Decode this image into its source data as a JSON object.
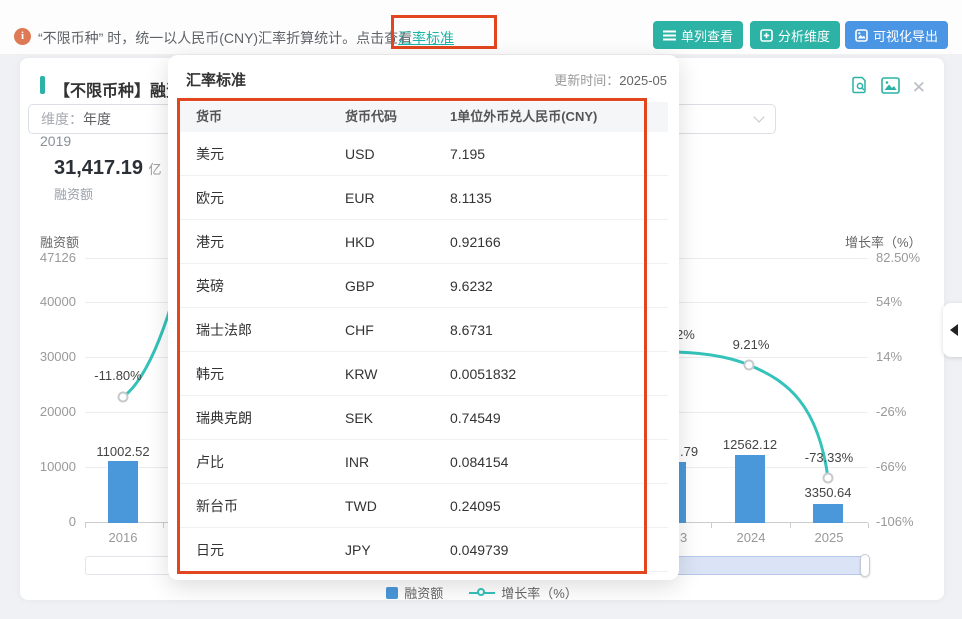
{
  "topbar": {
    "notice": "“不限币种” 时，统一以人民币(CNY)汇率折算统计。点击查看",
    "link_label": "汇率标准",
    "buttons": [
      {
        "label": "单列查看",
        "icon": "list-icon"
      },
      {
        "label": "分析维度",
        "icon": "add-dimension-icon"
      },
      {
        "label": "可视化导出",
        "icon": "export-image-icon"
      }
    ]
  },
  "card": {
    "title": "【不限币种】融资趋势",
    "dimension_select": {
      "label": "维度：",
      "value": "年度"
    },
    "kpi": {
      "year": "2019",
      "value": "31,417.19",
      "unit": "亿",
      "metric": "融资额"
    },
    "action_icons": [
      "doc-search-icon",
      "image-icon",
      "close-icon"
    ],
    "legend": [
      {
        "label": "融资额",
        "type": "bar",
        "swatch": "#4a97d9"
      },
      {
        "label": "增长率（%）",
        "type": "line",
        "swatch": "#35c2ba"
      }
    ]
  },
  "chart_data": {
    "type": "bar+line",
    "title": "【不限币种】融资趋势",
    "left_axis": {
      "label": "融资额",
      "ticks": [
        "47126",
        "40000",
        "30000",
        "20000",
        "10000",
        "0"
      ],
      "ylim": [
        0,
        47126
      ]
    },
    "right_axis": {
      "label": "增长率（%）",
      "ticks": [
        "82.50%",
        "54%",
        "14%",
        "-26%",
        "-66%",
        "-106%"
      ],
      "ylim": [
        -106,
        82.5
      ]
    },
    "x_axis": {
      "visible_labels": [
        "2016",
        "3",
        "2024",
        "2025"
      ]
    },
    "series": [
      {
        "name": "融资额",
        "type": "bar",
        "unit": "亿",
        "visible_points": [
          {
            "x": "2016",
            "value": 11002.52,
            "label": "11002.52"
          },
          {
            "x": "2024",
            "value": 12562.12,
            "label": "12562.12"
          },
          {
            "x": "2025",
            "value": 3350.64,
            "label": "3350.64"
          }
        ]
      },
      {
        "name": "增长率（%）",
        "type": "line",
        "visible_points": [
          {
            "x": "2016",
            "value": -11.8,
            "label": "-11.80%"
          },
          {
            "x": "2024",
            "value": 9.21,
            "label": "9.21%"
          },
          {
            "x": "2025",
            "value": -73.33,
            "label": "-73.33%"
          }
        ]
      }
    ],
    "partial_labels": {
      "bar_2023": ".79",
      "line_2023": "2%",
      "x_2023": "3"
    },
    "grid": true,
    "legend_position": "bottom"
  },
  "modal": {
    "title": "汇率标准",
    "update_label": "更新时间：",
    "update_value": "2025-05",
    "table": {
      "headers": [
        "货币",
        "货币代码",
        "1单位外币兑人民币(CNY)"
      ],
      "rows": [
        {
          "name": "美元",
          "code": "USD",
          "rate": "7.195"
        },
        {
          "name": "欧元",
          "code": "EUR",
          "rate": "8.1135"
        },
        {
          "name": "港元",
          "code": "HKD",
          "rate": "0.92166"
        },
        {
          "name": "英磅",
          "code": "GBP",
          "rate": "9.6232"
        },
        {
          "name": "瑞士法郎",
          "code": "CHF",
          "rate": "8.6731"
        },
        {
          "name": "韩元",
          "code": "KRW",
          "rate": "0.0051832"
        },
        {
          "name": "瑞典克朗",
          "code": "SEK",
          "rate": "0.74549"
        },
        {
          "name": "卢比",
          "code": "INR",
          "rate": "0.084154"
        },
        {
          "name": "新台币",
          "code": "TWD",
          "rate": "0.24095"
        },
        {
          "name": "日元",
          "code": "JPY",
          "rate": "0.049739"
        }
      ]
    }
  },
  "colors": {
    "accent_teal": "#2cb3a5",
    "accent_blue": "#4a96e4",
    "bar_blue": "#4a97d9",
    "line_teal": "#35c2ba",
    "annotation_red": "#e2461f",
    "link_teal": "#1cb3a8"
  }
}
